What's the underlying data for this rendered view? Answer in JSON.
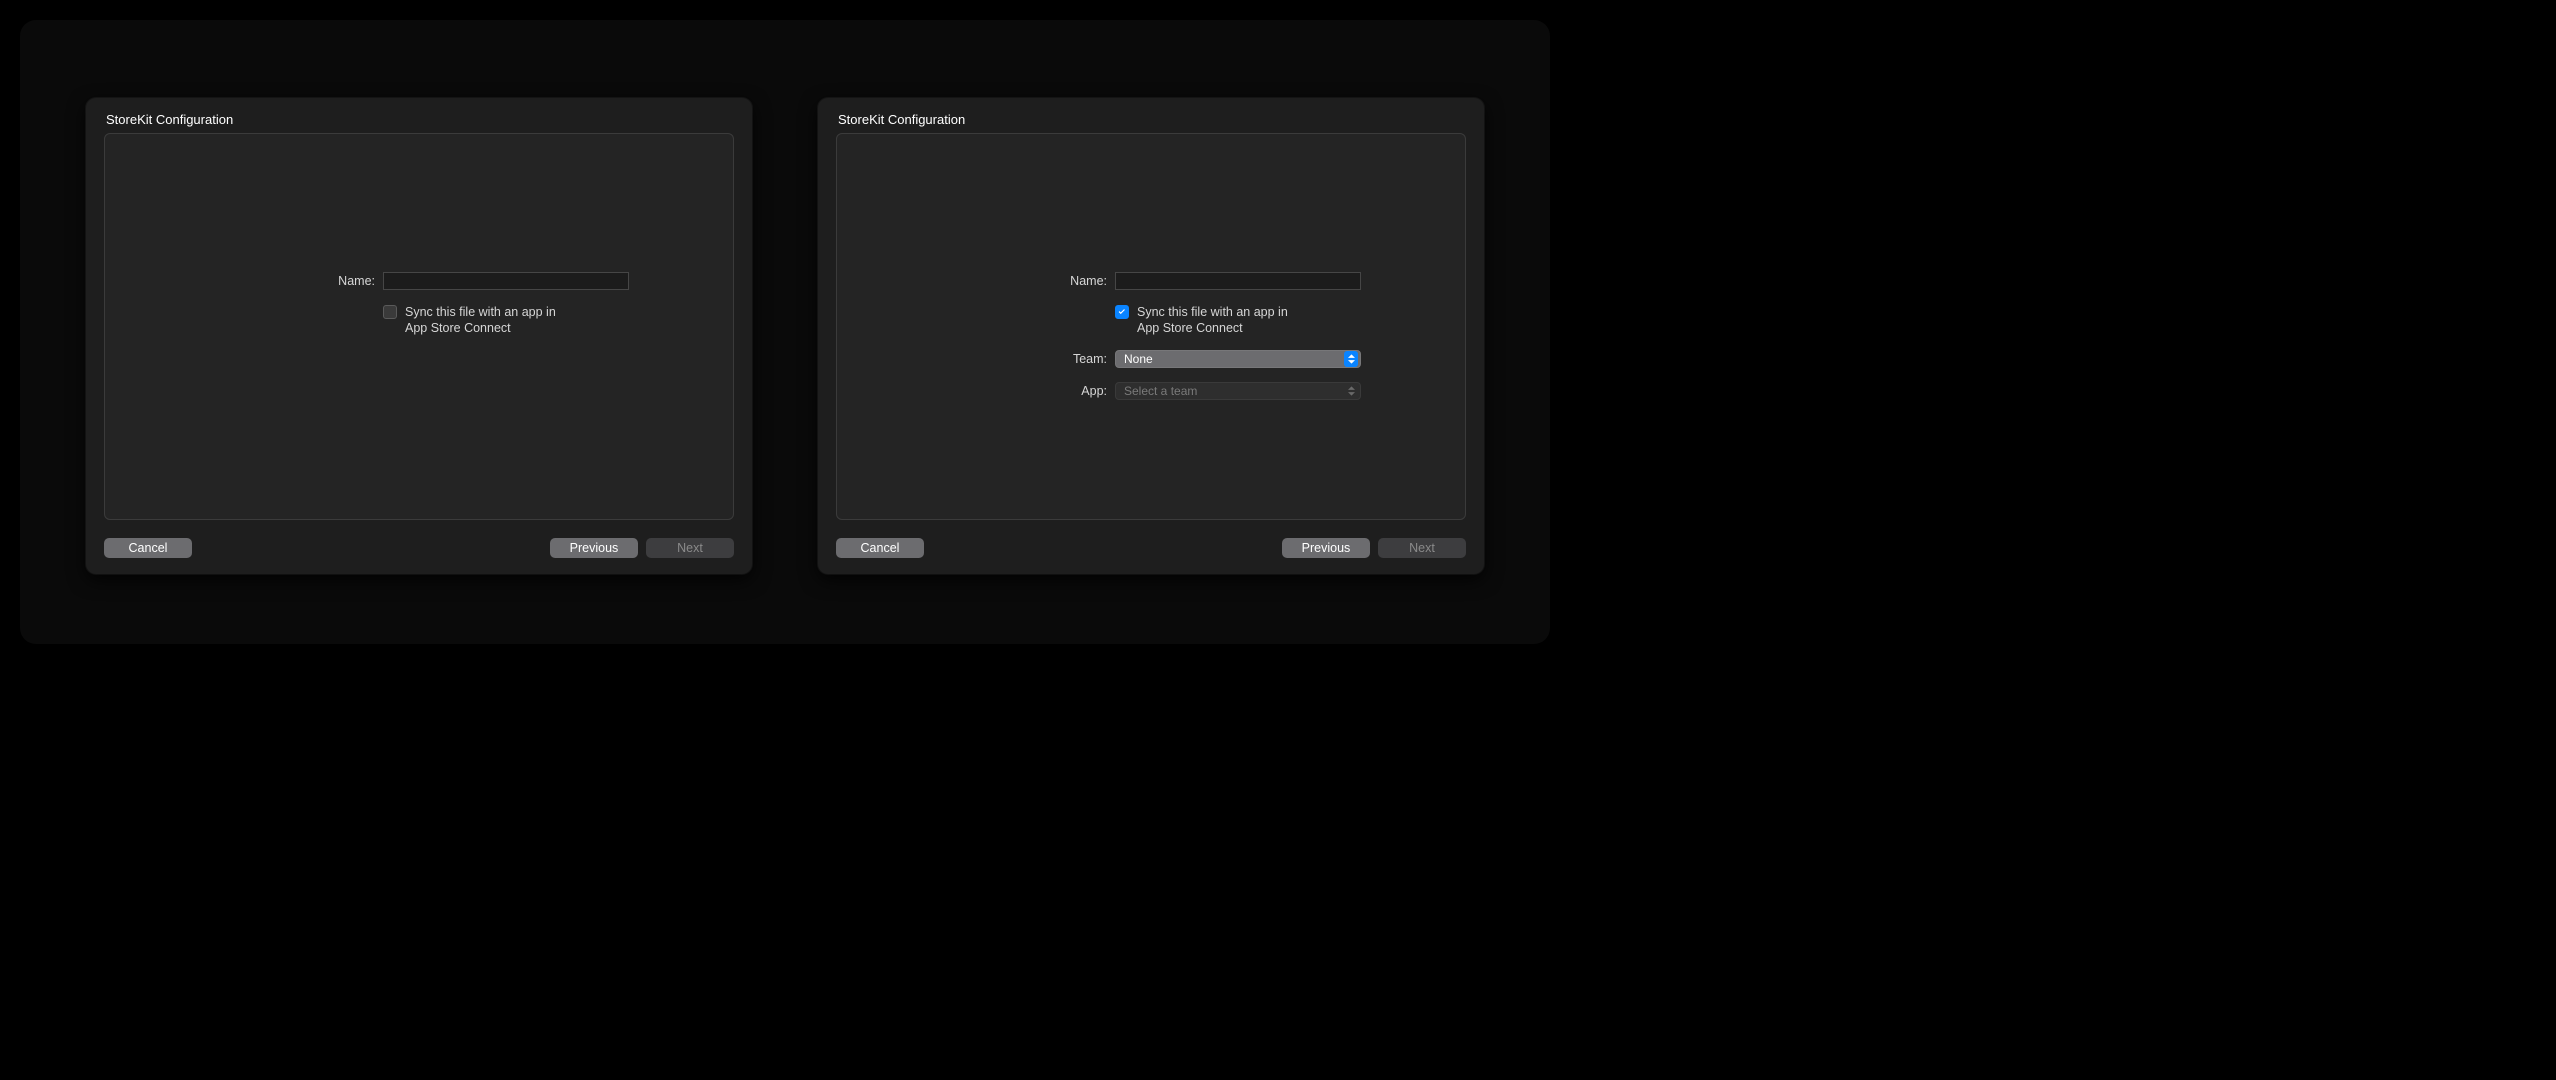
{
  "dialogs": [
    {
      "title": "StoreKit Configuration",
      "fields": {
        "name_label": "Name:",
        "name_value": "",
        "sync_label": "Sync this file with an app in App Store Connect",
        "sync_checked": false
      },
      "buttons": {
        "cancel": "Cancel",
        "previous": "Previous",
        "next": "Next",
        "next_disabled": true
      }
    },
    {
      "title": "StoreKit Configuration",
      "fields": {
        "name_label": "Name:",
        "name_value": "",
        "sync_label": "Sync this file with an app in App Store Connect",
        "sync_checked": true,
        "team_label": "Team:",
        "team_value": "None",
        "app_label": "App:",
        "app_placeholder": "Select a team"
      },
      "buttons": {
        "cancel": "Cancel",
        "previous": "Previous",
        "next": "Next",
        "next_disabled": true
      }
    }
  ]
}
